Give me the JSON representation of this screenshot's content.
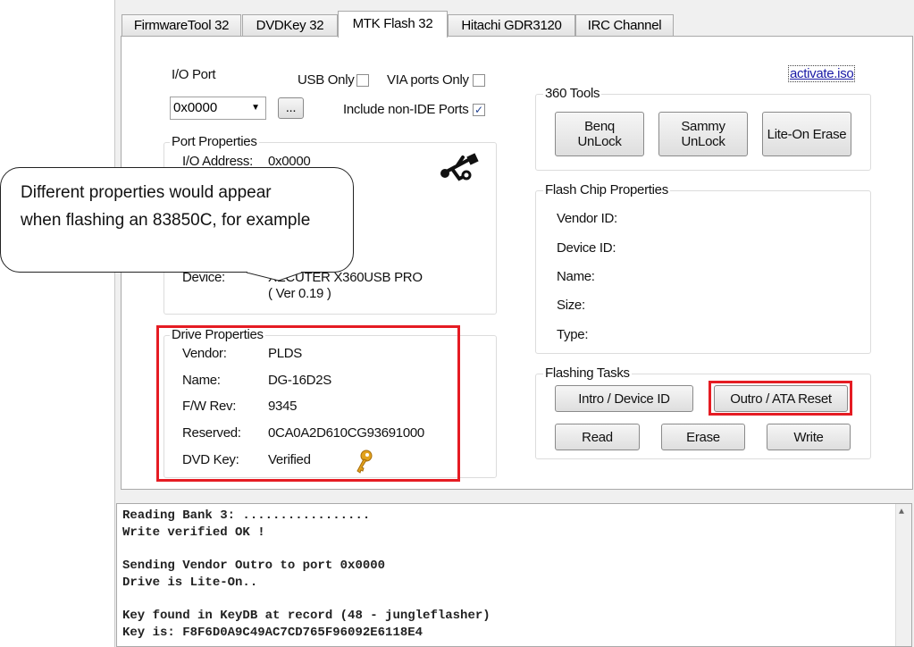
{
  "tabs": [
    {
      "label": "FirmwareTool 32",
      "active": false
    },
    {
      "label": "DVDKey 32",
      "active": false
    },
    {
      "label": "MTK Flash 32",
      "active": true
    },
    {
      "label": "Hitachi GDR3120",
      "active": false
    },
    {
      "label": "IRC Channel",
      "active": false
    }
  ],
  "io": {
    "port_label": "I/O Port",
    "port_value": "0x0000",
    "browse_label": "...",
    "usb_only_label": "USB Only",
    "usb_only_checked": false,
    "via_only_label": "VIA ports Only",
    "via_only_checked": false,
    "non_ide_label": "Include non-IDE Ports",
    "non_ide_checked": true
  },
  "port_properties": {
    "title": "Port Properties",
    "io_address_label": "I/O Address:",
    "io_address_value": "0x0000",
    "device_label": "Device:",
    "device_value": "XECUTER X360USB PRO",
    "device_version": "( Ver 0.19 )"
  },
  "drive_properties": {
    "title": "Drive Properties",
    "rows": [
      {
        "label": "Vendor:",
        "value": "PLDS"
      },
      {
        "label": "Name:",
        "value": "DG-16D2S"
      },
      {
        "label": "F/W Rev:",
        "value": "9345"
      },
      {
        "label": "Reserved:",
        "value": "0CA0A2D610CG93691000"
      },
      {
        "label": "DVD Key:",
        "value": "Verified"
      }
    ]
  },
  "link": {
    "label": "activate.iso"
  },
  "tools_360": {
    "title": "360 Tools",
    "buttons": [
      "Benq\nUnLock",
      "Sammy\nUnLock",
      "Lite-On Erase"
    ]
  },
  "flash_chip": {
    "title": "Flash Chip Properties",
    "labels": [
      "Vendor ID:",
      "Device ID:",
      "Name:",
      "Size:",
      "Type:"
    ]
  },
  "flashing_tasks": {
    "title": "Flashing Tasks",
    "intro_label": "Intro / Device ID",
    "outro_label": "Outro / ATA Reset",
    "read_label": "Read",
    "erase_label": "Erase",
    "write_label": "Write"
  },
  "log_lines": [
    "Reading Bank 3: .................",
    "Write verified OK !",
    "",
    "Sending Vendor Outro to port 0x0000",
    "Drive is Lite-On..",
    "",
    "Key found in KeyDB at record (48 - jungleflasher)",
    "Key is: F8F6D0A9C49AC7CD765F96092E6118E4"
  ],
  "callout": {
    "text_line1": "Different properties would appear",
    "text_line2": "when flashing an 83850C, for example"
  },
  "colors": {
    "highlight": "#e51c23",
    "link": "#1a1aa6",
    "key_icon": "#e2a21d"
  }
}
